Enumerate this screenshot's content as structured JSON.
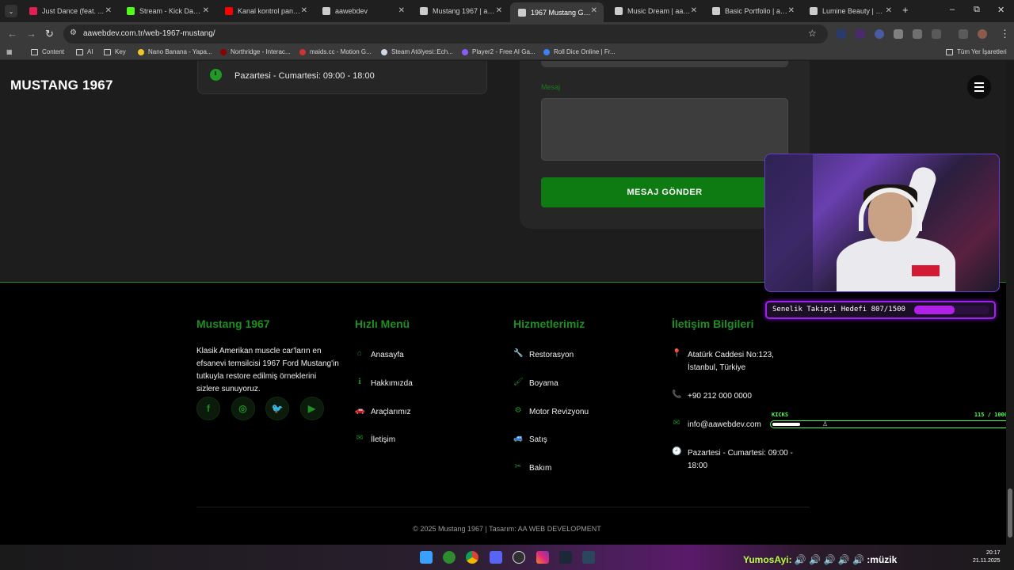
{
  "browser": {
    "tabs": [
      {
        "label": "Just Dance (feat. ...",
        "favicon_color": "#e02050"
      },
      {
        "label": "Stream - Kick Dashbo...",
        "favicon_color": "#53fc18"
      },
      {
        "label": "Kanal kontrol paneli -",
        "favicon_color": "#ff0000"
      },
      {
        "label": "aawebdev",
        "favicon_color": "#cccccc"
      },
      {
        "label": "Mustang 1967 | aawe...",
        "favicon_color": "#cccccc"
      },
      {
        "label": "1967 Mustang Garag...",
        "favicon_color": "#cccccc"
      },
      {
        "label": "Music Dream | aaweb...",
        "favicon_color": "#cccccc"
      },
      {
        "label": "Basic Portfolio | aawe...",
        "favicon_color": "#cccccc"
      },
      {
        "label": "Lumine Beauty | aawe...",
        "favicon_color": "#cccccc"
      }
    ],
    "active_tab_index": 5,
    "new_tab": "+",
    "window_controls": {
      "minimize": "–",
      "maximize": "⧉",
      "close": "✕"
    },
    "url": "aawebdev.com.tr/web-1967-mustang/",
    "bookmarks": [
      {
        "label": "Content",
        "type": "folder"
      },
      {
        "label": "AI",
        "type": "folder"
      },
      {
        "label": "Key",
        "type": "folder"
      },
      {
        "label": "Nano Banana - Yapa...",
        "type": "site",
        "color": "#f4c430"
      },
      {
        "label": "Northridge - Interac...",
        "type": "site",
        "color": "#8b0000"
      },
      {
        "label": "maids.cc - Motion G...",
        "type": "site",
        "color": "#cc3333"
      },
      {
        "label": "Steam Atölyesi::Ech...",
        "type": "site",
        "color": "#d0d8e8"
      },
      {
        "label": "Player2 - Free AI Ga...",
        "type": "site",
        "color": "#8a5cf6"
      },
      {
        "label": "Roll Dice Online | Fr...",
        "type": "site",
        "color": "#3b82f6"
      }
    ],
    "all_bookmarks": "Tüm Yer İşaretleri"
  },
  "site": {
    "brand": "MUSTANG 1967",
    "contact": {
      "hours_card_text": "Pazartesi - Cumartesi: 09:00 - 18:00",
      "message_label": "Mesaj",
      "send_button": "MESAJ GÖNDER"
    },
    "footer": {
      "about_title": "Mustang 1967",
      "about_text": "Klasik Amerikan muscle car'ların en efsanevi temsilcisi 1967 Ford Mustang'in tutkuyla restore edilmiş örneklerini sizlere sunuyoruz.",
      "social": [
        {
          "icon": "facebook-icon",
          "glyph": "f"
        },
        {
          "icon": "instagram-icon",
          "glyph": "◎"
        },
        {
          "icon": "twitter-icon",
          "glyph": "🐦"
        },
        {
          "icon": "youtube-icon",
          "glyph": "▶"
        }
      ],
      "quick_menu_title": "Hızlı Menü",
      "quick_menu": [
        {
          "label": "Anasayfa",
          "icon": "home-icon",
          "glyph": "⌂"
        },
        {
          "label": "Hakkımızda",
          "icon": "info-icon",
          "glyph": "ℹ"
        },
        {
          "label": "Araçlarımız",
          "icon": "car-icon",
          "glyph": "🚗"
        },
        {
          "label": "İletişim",
          "icon": "envelope-icon",
          "glyph": "✉"
        }
      ],
      "services_title": "Hizmetlerimiz",
      "services": [
        {
          "label": "Restorasyon",
          "icon": "wrench-icon",
          "glyph": "🔧"
        },
        {
          "label": "Boyama",
          "icon": "paint-brush-icon",
          "glyph": "🖌"
        },
        {
          "label": "Motor Revizyonu",
          "icon": "gear-icon",
          "glyph": "⚙"
        },
        {
          "label": "Satış",
          "icon": "car-side-icon",
          "glyph": "🚙"
        },
        {
          "label": "Bakım",
          "icon": "tools-icon",
          "glyph": "✂"
        }
      ],
      "contact_title": "İletişim Bilgileri",
      "contact_items": [
        {
          "label": "Atatürk Caddesi No:123, İstanbul, Türkiye",
          "icon": "map-pin-icon",
          "glyph": "📍"
        },
        {
          "label": "+90 212 000 0000",
          "icon": "phone-icon",
          "glyph": "📞"
        },
        {
          "label": "info@aawebdev.com",
          "icon": "envelope-icon",
          "glyph": "✉"
        },
        {
          "label": "Pazartesi - Cumartesi: 09:00 - 18:00",
          "icon": "clock-icon",
          "glyph": "🕘"
        }
      ],
      "copyright": "© 2025 Mustang 1967 | Tasarım: AA WEB DEVELOPMENT"
    }
  },
  "overlays": {
    "follower_goal": {
      "label": "Senelik Takipçi Hedefi 807/1500",
      "current": 807,
      "target": 1500
    },
    "kicks": {
      "label": "KICKS",
      "count": "115 / 1000",
      "current": 115,
      "target": 1000
    }
  },
  "taskbar": {
    "ticker_user": "YumosAyi:",
    "ticker_text": " 🔊 🔊 🔊 🔊 🔊 :müzik",
    "time": "20:17",
    "date": "21.11.2025"
  }
}
